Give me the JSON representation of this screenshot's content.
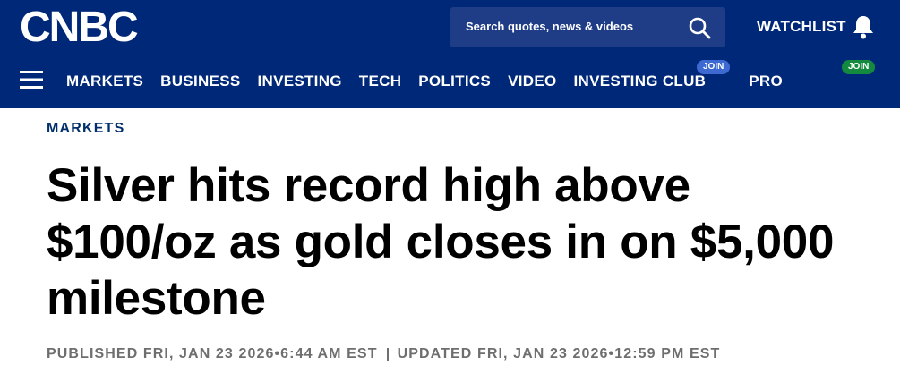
{
  "header": {
    "logo_text": "CNBC",
    "search_placeholder": "Search quotes, news & videos",
    "watchlist_label": "WATCHLIST",
    "colors": {
      "bar": "#002878",
      "search_bg": "#1f3d86",
      "join_club": "#3c6ad2",
      "join_pro": "#138a3e"
    }
  },
  "nav": {
    "items": [
      {
        "label": "MARKETS"
      },
      {
        "label": "BUSINESS"
      },
      {
        "label": "INVESTING"
      },
      {
        "label": "TECH"
      },
      {
        "label": "POLITICS"
      },
      {
        "label": "VIDEO"
      },
      {
        "label": "INVESTING CLUB",
        "badge": "JOIN"
      },
      {
        "label": "PRO",
        "badge": "JOIN"
      }
    ]
  },
  "article": {
    "section": "MARKETS",
    "headline": "Silver hits record high above $100/oz as gold closes in on $5,000 milestone",
    "published": "PUBLISHED FRI, JAN 23 2026•6:44 AM EST",
    "updated": "UPDATED FRI, JAN 23 2026•12:59 PM EST"
  }
}
